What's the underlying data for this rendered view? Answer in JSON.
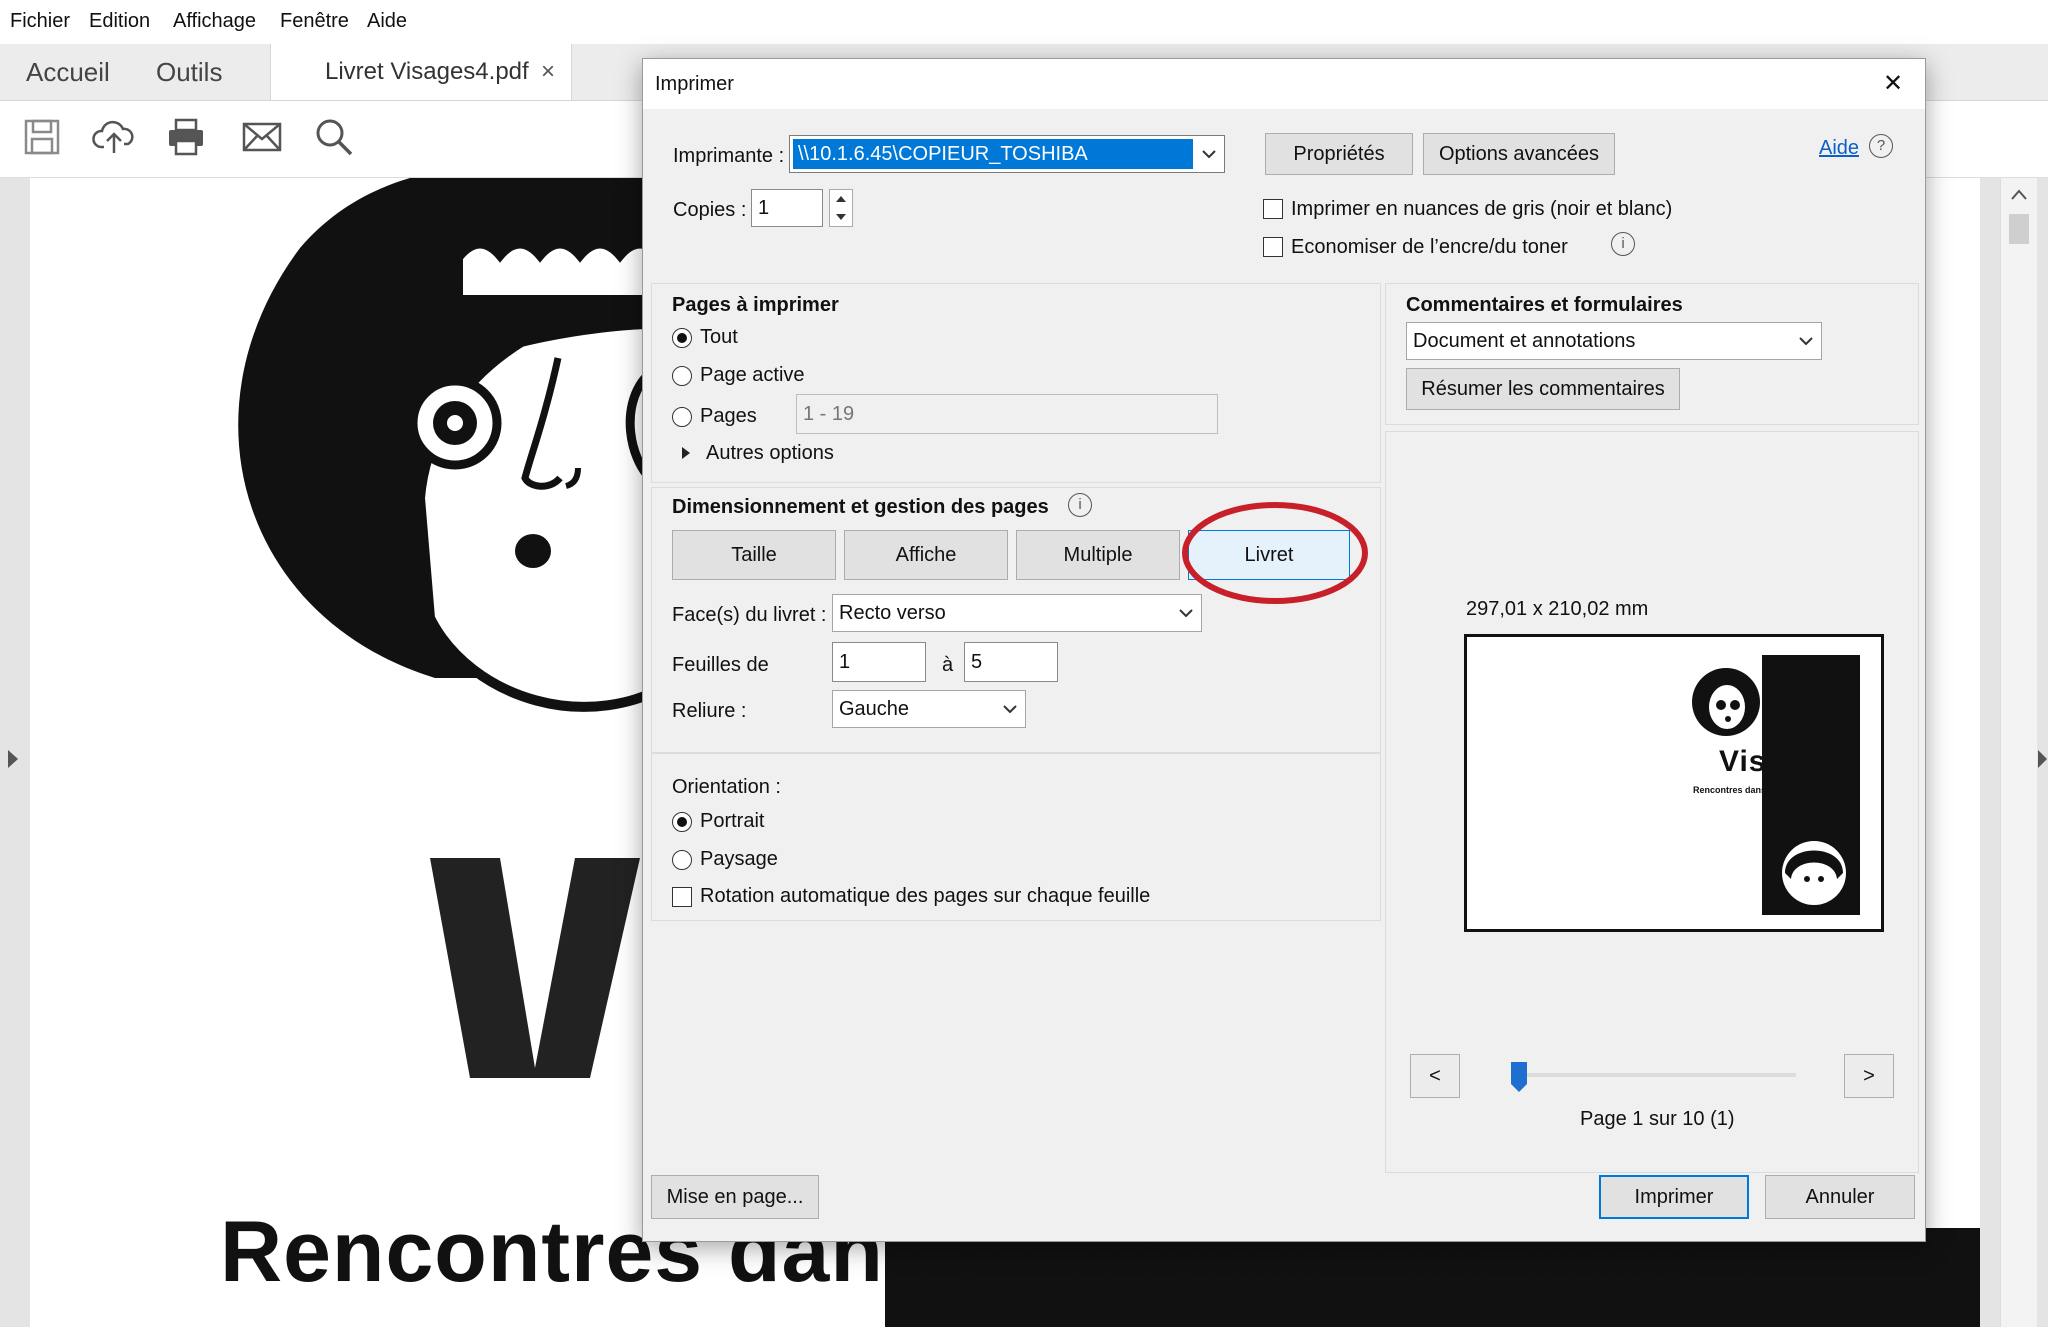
{
  "menubar": {
    "items": [
      "Fichier",
      "Edition",
      "Affichage",
      "Fenêtre",
      "Aide"
    ]
  },
  "tabs": {
    "home": "Accueil",
    "tools": "Outils",
    "document": "Livret Visages4.pdf",
    "close": "×"
  },
  "toolbar": {
    "icons": [
      "save-icon",
      "cloud-upload-icon",
      "printer-icon",
      "mail-icon",
      "search-icon"
    ]
  },
  "document": {
    "big_letter": "V",
    "subtitle": "Rencontres dans la Galerie du Temps"
  },
  "dialog": {
    "title": "Imprimer",
    "close": "✕",
    "printer": {
      "label": "Imprimante :",
      "value": "\\\\10.1.6.45\\COPIEUR_TOSHIBA",
      "properties_button": "Propriétés",
      "advanced_button": "Options avancées",
      "help_link": "Aide",
      "help_icon": "?"
    },
    "copies": {
      "label": "Copies :",
      "value": "1"
    },
    "grayscale": {
      "label": "Imprimer en nuances de gris (noir et blanc)",
      "checked": false
    },
    "save_ink": {
      "label": "Economiser de l’encre/du toner",
      "checked": false,
      "info": "i"
    },
    "pages_section": {
      "title": "Pages à imprimer",
      "all": "Tout",
      "current": "Page active",
      "pages": "Pages",
      "pages_range": "1 - 19",
      "more_options": "Autres options",
      "selected": "all"
    },
    "sizing_section": {
      "title": "Dimensionnement et gestion des pages",
      "info": "i",
      "tabs": [
        "Taille",
        "Affiche",
        "Multiple",
        "Livret"
      ],
      "active_tab": "Livret",
      "booklet_sides_label": "Face(s) du livret :",
      "booklet_sides_value": "Recto verso",
      "sheets_label": "Feuilles de",
      "sheets_from": "1",
      "sheets_to_label": "à",
      "sheets_to": "5",
      "binding_label": "Reliure :",
      "binding_value": "Gauche"
    },
    "orientation_section": {
      "title": "Orientation :",
      "portrait": "Portrait",
      "landscape": "Paysage",
      "selected": "portrait",
      "auto_rotate": "Rotation automatique des pages sur chaque feuille",
      "auto_rotate_checked": false
    },
    "comments_section": {
      "title": "Commentaires et formulaires",
      "value": "Document et annotations",
      "summarize_button": "Résumer les commentaires"
    },
    "preview": {
      "dimensions": "297,01 x 210,02 mm",
      "thumb_title": "Visages",
      "thumb_subtitle": "Rencontres dans la Galerie du Temps",
      "prev": "<",
      "next": ">",
      "page_info": "Page 1 sur 10 (1)",
      "slider_fraction": 0
    },
    "setup_button": "Mise en page...",
    "print_button": "Imprimer",
    "cancel_button": "Annuler"
  },
  "colors": {
    "accent": "#0078d7",
    "highlight_circle": "#c8202a",
    "selection": "#0078d7"
  }
}
